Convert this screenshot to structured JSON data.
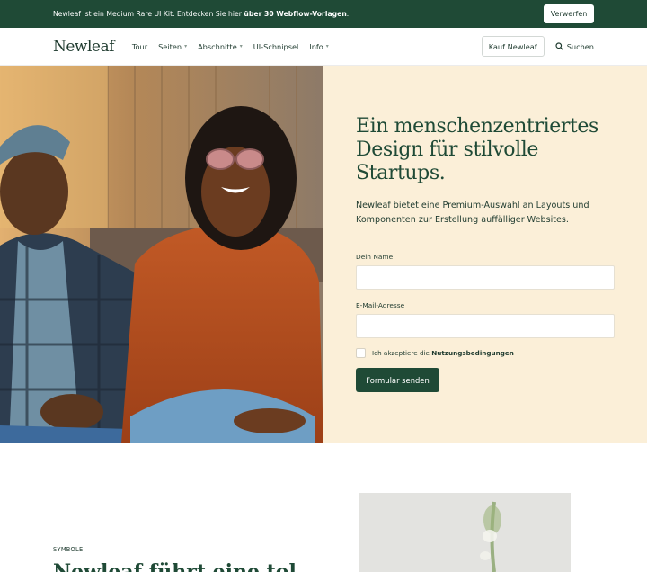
{
  "announcement": {
    "text_before": "Newleaf ist ein Medium Rare UI Kit. Entdecken Sie hier ",
    "text_bold": "über 30 Webflow-Vorlagen",
    "text_after": ".",
    "dismiss_label": "Verwerfen"
  },
  "nav": {
    "logo": "Newleaf",
    "links": [
      {
        "label": "Tour",
        "dropdown": false
      },
      {
        "label": "Seiten",
        "dropdown": true
      },
      {
        "label": "Abschnitte",
        "dropdown": true
      },
      {
        "label": "UI-Schnipsel",
        "dropdown": false
      },
      {
        "label": "Info",
        "dropdown": true
      }
    ],
    "buy_label": "Kauf Newleaf",
    "search_label": "Suchen"
  },
  "hero": {
    "title": "Ein menschenzentriertes Design für stilvolle Startups.",
    "description": "Newleaf bietet eine Premium-Auswahl an Layouts und Komponenten zur Erstellung auffälliger Websites.",
    "form": {
      "name_label": "Dein Name",
      "name_value": "",
      "email_label": "E-Mail-Adresse",
      "email_value": "",
      "terms_prefix": "Ich akzeptiere die ",
      "terms_link": "Nutzungsbedingungen",
      "submit_label": "Formular senden"
    }
  },
  "section2": {
    "eyebrow": "SYMBOLE",
    "heading": "Newleaf führt eine tol"
  },
  "colors": {
    "brand_green": "#1f4a36",
    "hero_panel": "#fbefd8"
  }
}
